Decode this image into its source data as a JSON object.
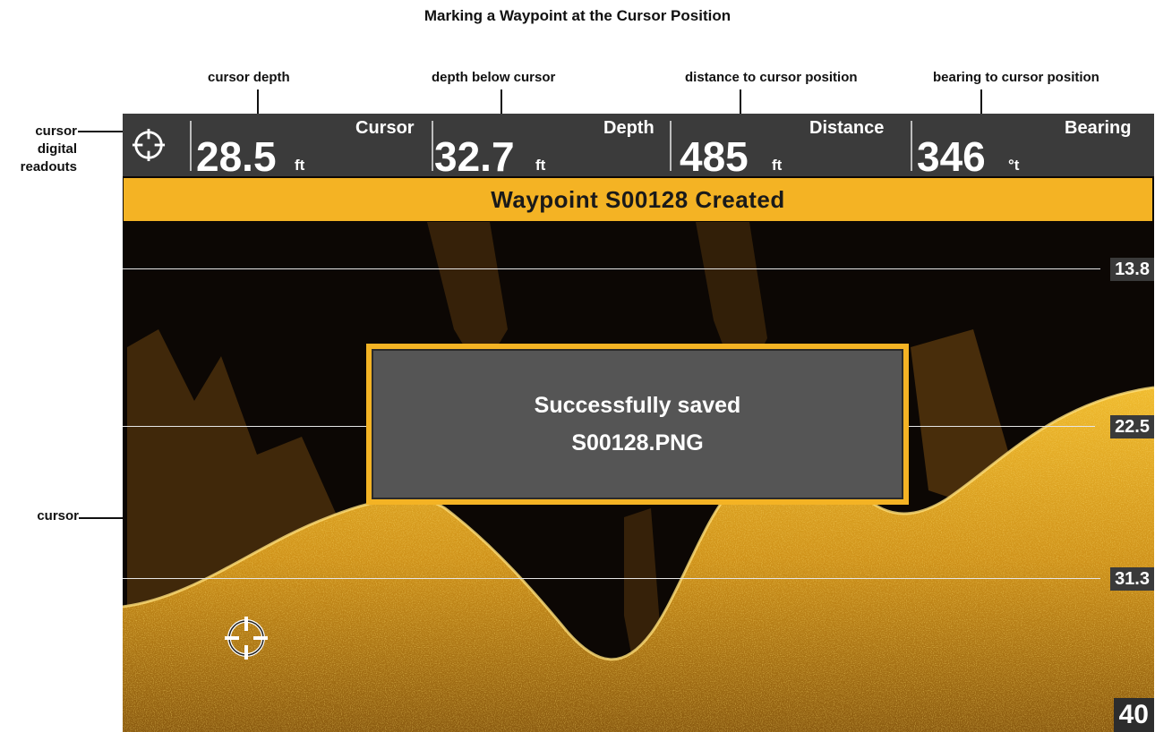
{
  "page_title": "Marking a Waypoint at the Cursor Position",
  "callouts": {
    "cursor_depth": "cursor depth",
    "depth_below_cursor": "depth below cursor",
    "distance_to_cursor": "distance to cursor position",
    "bearing_to_cursor": "bearing to cursor position",
    "cursor_digital_readouts": [
      "cursor",
      "digital",
      "readouts"
    ],
    "cursor": "cursor"
  },
  "readouts": [
    {
      "label": "Cursor",
      "value": "28.5",
      "unit": "ft"
    },
    {
      "label": "Depth",
      "value": "32.7",
      "unit": "ft"
    },
    {
      "label": "Distance",
      "value": "485",
      "unit": "ft"
    },
    {
      "label": "Bearing",
      "value": "346",
      "unit": "°t"
    }
  ],
  "banner": "Waypoint S00128 Created",
  "dialog": {
    "line1": "Successfully saved",
    "line2": "S00128.PNG"
  },
  "depth_marks": [
    "13.8",
    "22.5",
    "31.3"
  ],
  "depth_scale": "40",
  "icons": {
    "readout_icon": "crosshair-icon",
    "sonar_cursor": "crosshair-icon"
  },
  "colors": {
    "accent": "#f4b324",
    "readout_bar": "#3b3b3b",
    "sonar_background": "#0c0704",
    "sonar_return": "#e2a41d",
    "dialog": "#555555"
  }
}
